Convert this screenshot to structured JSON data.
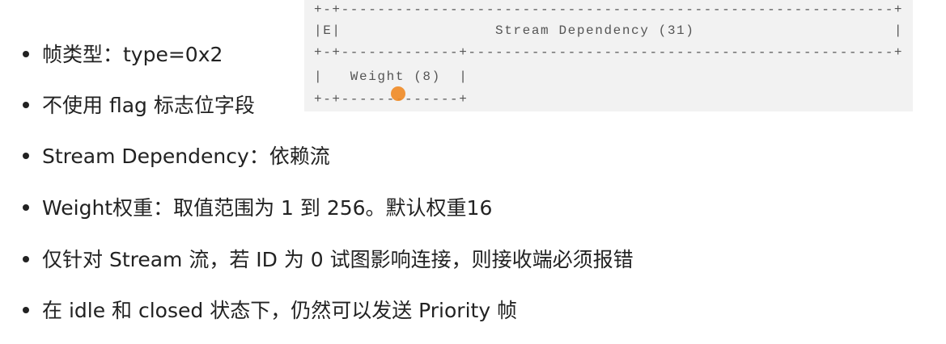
{
  "diagram": {
    "lines": [
      "+-+-------------------------------------------------------------+",
      "|E|                 Stream Dependency (31)                      |",
      "+-+-------------+-----------------------------------------------+",
      "|   Weight (8)  |",
      "+-+-------------+"
    ]
  },
  "bullets": [
    "帧类型：type=0x2",
    "不使用 flag 标志位字段",
    "Stream Dependency：依赖流",
    "Weight权重：取值范围为 1 到 256。默认权重16",
    "仅针对 Stream 流，若 ID 为 0 试图影响连接，则接收端必须报错",
    "在 idle 和 closed 状态下，仍然可以发送 Priority 帧"
  ],
  "colors": {
    "cursor": "#f08a24",
    "diagram_bg": "#f2f2f2"
  }
}
